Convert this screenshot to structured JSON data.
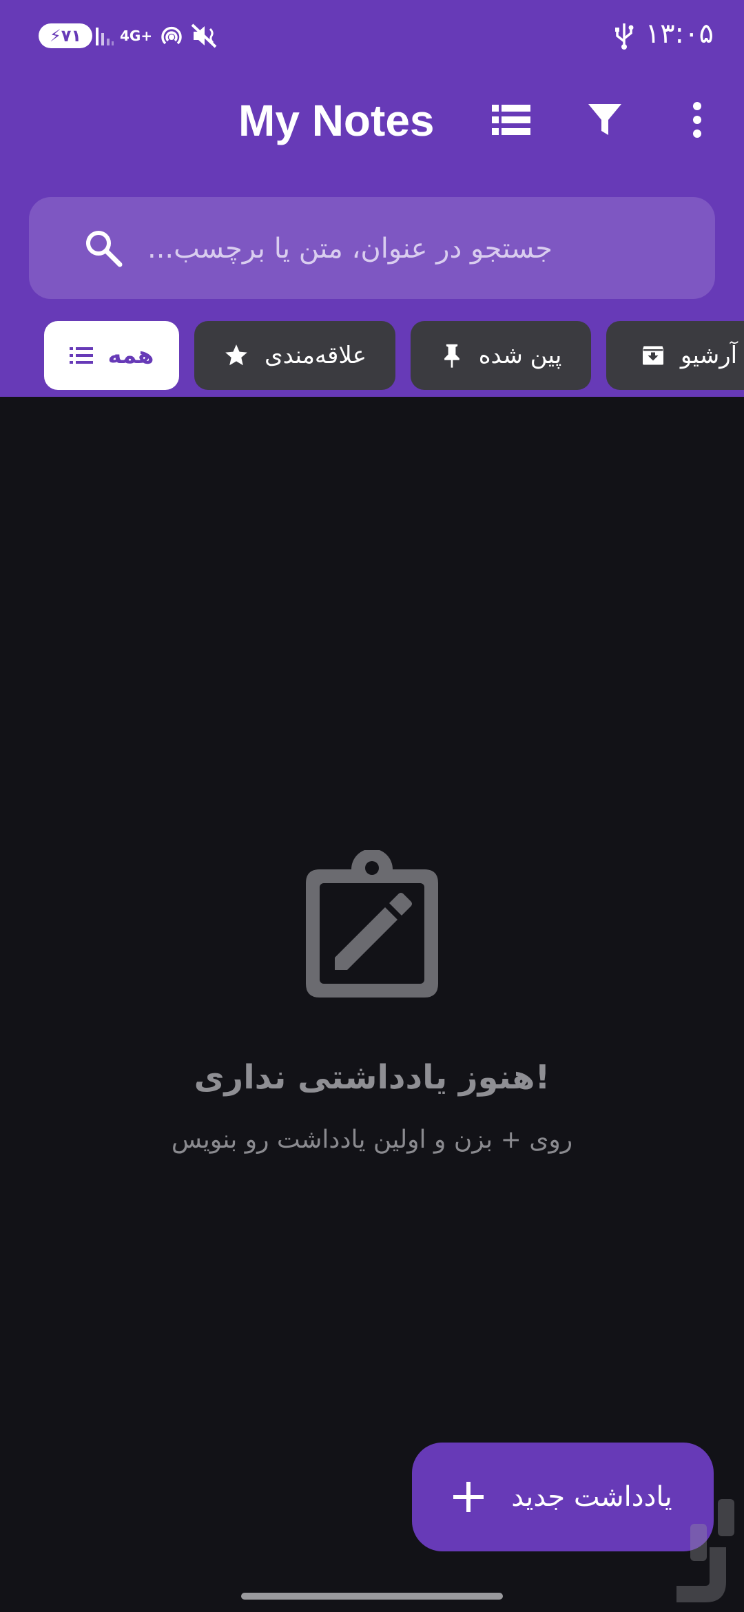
{
  "status_bar": {
    "time": "۱۳:۰۵",
    "battery": "۷۱",
    "network": "4G+",
    "icons": [
      "usb-icon",
      "battery-charging-icon",
      "signal-icon",
      "hotspot-icon",
      "mute-icon"
    ]
  },
  "toolbar": {
    "title": "My Notes",
    "icons": [
      "view-list-icon",
      "filter-icon",
      "more-vert-icon"
    ]
  },
  "search": {
    "placeholder": "...جستجو در عنوان، متن یا برچسب",
    "value": ""
  },
  "chips": [
    {
      "label": "همه",
      "icon": "list-icon",
      "selected": true
    },
    {
      "label": "علاقه‌مندی",
      "icon": "star-icon",
      "selected": false
    },
    {
      "label": "پین شده",
      "icon": "pin-icon",
      "selected": false
    },
    {
      "label": "آرشیو",
      "icon": "archive-icon",
      "selected": false
    }
  ],
  "empty_state": {
    "icon": "clipboard-edit-icon",
    "title": "!هنوز یادداشتی نداری",
    "subtitle": "روی + بزن و اولین یادداشت رو بنویس"
  },
  "fab": {
    "label": "یادداشت جدید",
    "icon": "plus-icon"
  },
  "colors": {
    "primary": "#673ab7",
    "search_bg": "#7e57c2",
    "background": "#121217",
    "chip_bg": "#3b3b40"
  }
}
